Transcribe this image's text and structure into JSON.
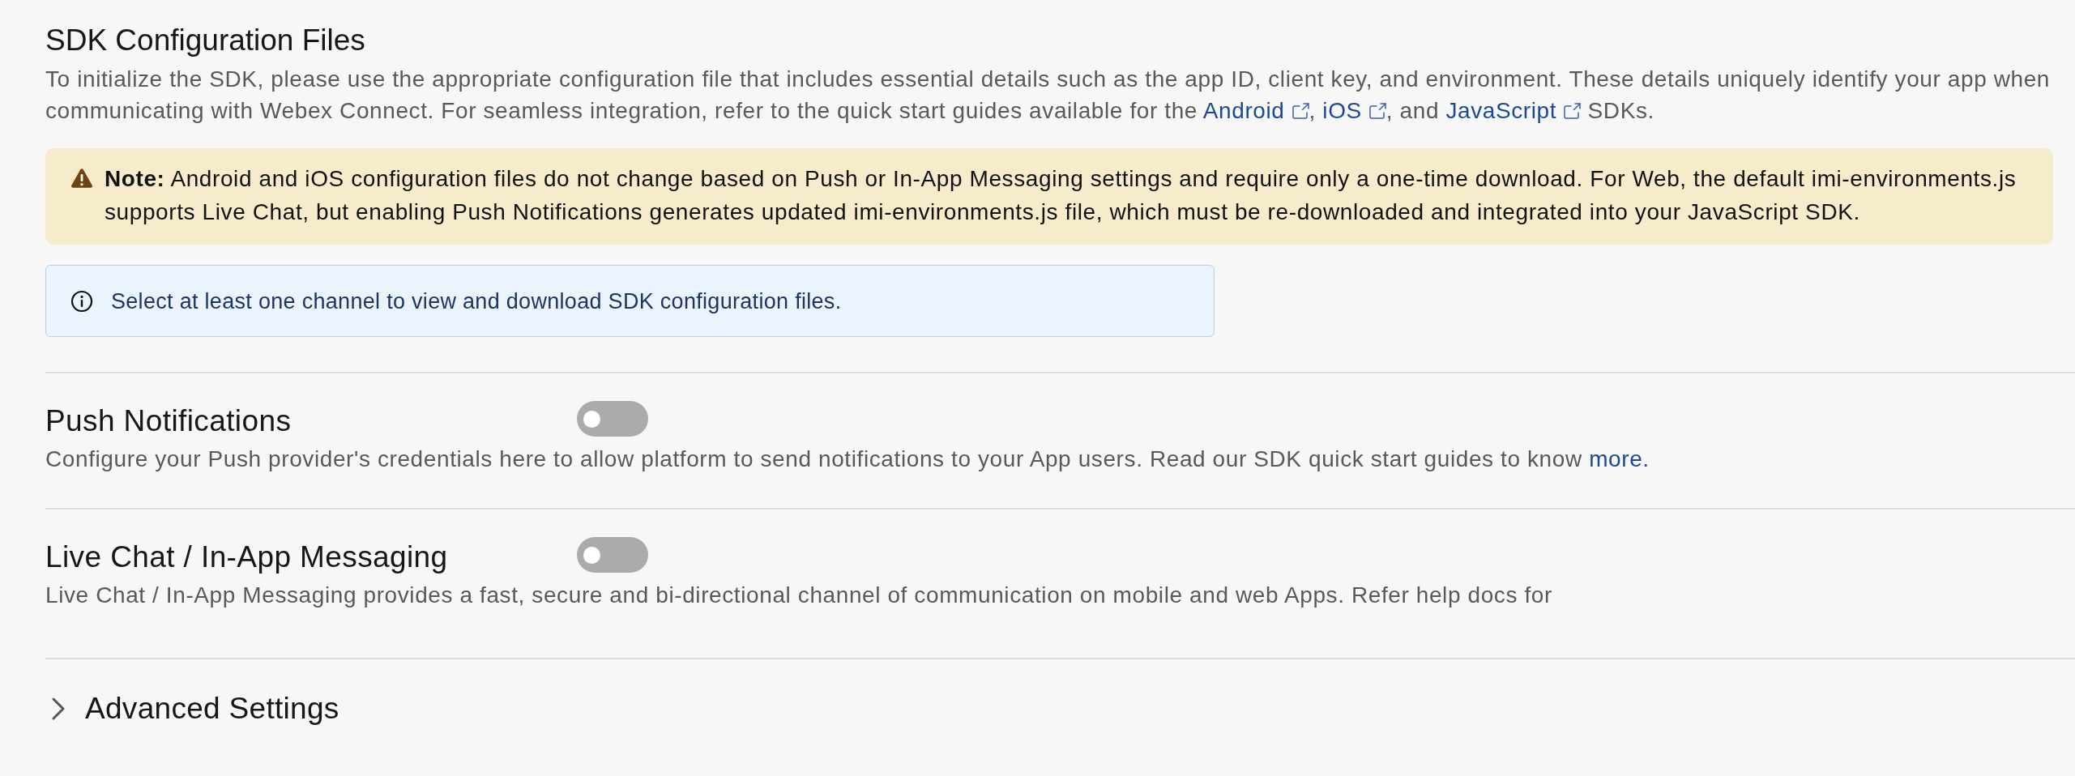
{
  "header": {
    "title": "SDK Configuration Files",
    "description": [
      {
        "kind": "text",
        "text": "To initialize the SDK, please use the appropriate configuration file that includes essential details such as the app ID, client key, and environment. These details uniquely identify your app when communicating with Webex Connect. For seamless integration, refer to the quick start guides available for the "
      },
      {
        "kind": "external_link",
        "text": "Android"
      },
      {
        "kind": "text",
        "text": ", "
      },
      {
        "kind": "external_link",
        "text": "iOS"
      },
      {
        "kind": "text",
        "text": ", and "
      },
      {
        "kind": "external_link",
        "text": "JavaScript"
      },
      {
        "kind": "text",
        "text": " SDKs."
      }
    ]
  },
  "note": {
    "text": "**Note:** Android and iOS configuration files do not change based on Push or In-App Messaging settings and require only a one-time download. For Web, the default imi-environments.js supports Live Chat, but enabling Push Notifications generates updated imi-environments.js file, which must be re-downloaded and integrated into your JavaScript SDK."
  },
  "info": {
    "text": "Select at least one channel to view and download SDK configuration files."
  },
  "channels": [
    {
      "title": "Push Notifications",
      "on": false,
      "description": [
        {
          "kind": "text",
          "text": "Configure your Push provider's credentials here to allow platform to send notifications to your App users. Read our SDK quick start guides to know "
        },
        {
          "kind": "link",
          "text": "more."
        }
      ]
    },
    {
      "title": "Live Chat / In-App Messaging",
      "on": false,
      "description": [
        {
          "kind": "text",
          "text": "Live Chat / In-App Messaging provides a fast, secure and bi-directional channel of communication on mobile and web Apps. Refer help docs for"
        }
      ]
    }
  ],
  "advanced": {
    "title": "Advanced Settings",
    "expanded": false
  }
}
